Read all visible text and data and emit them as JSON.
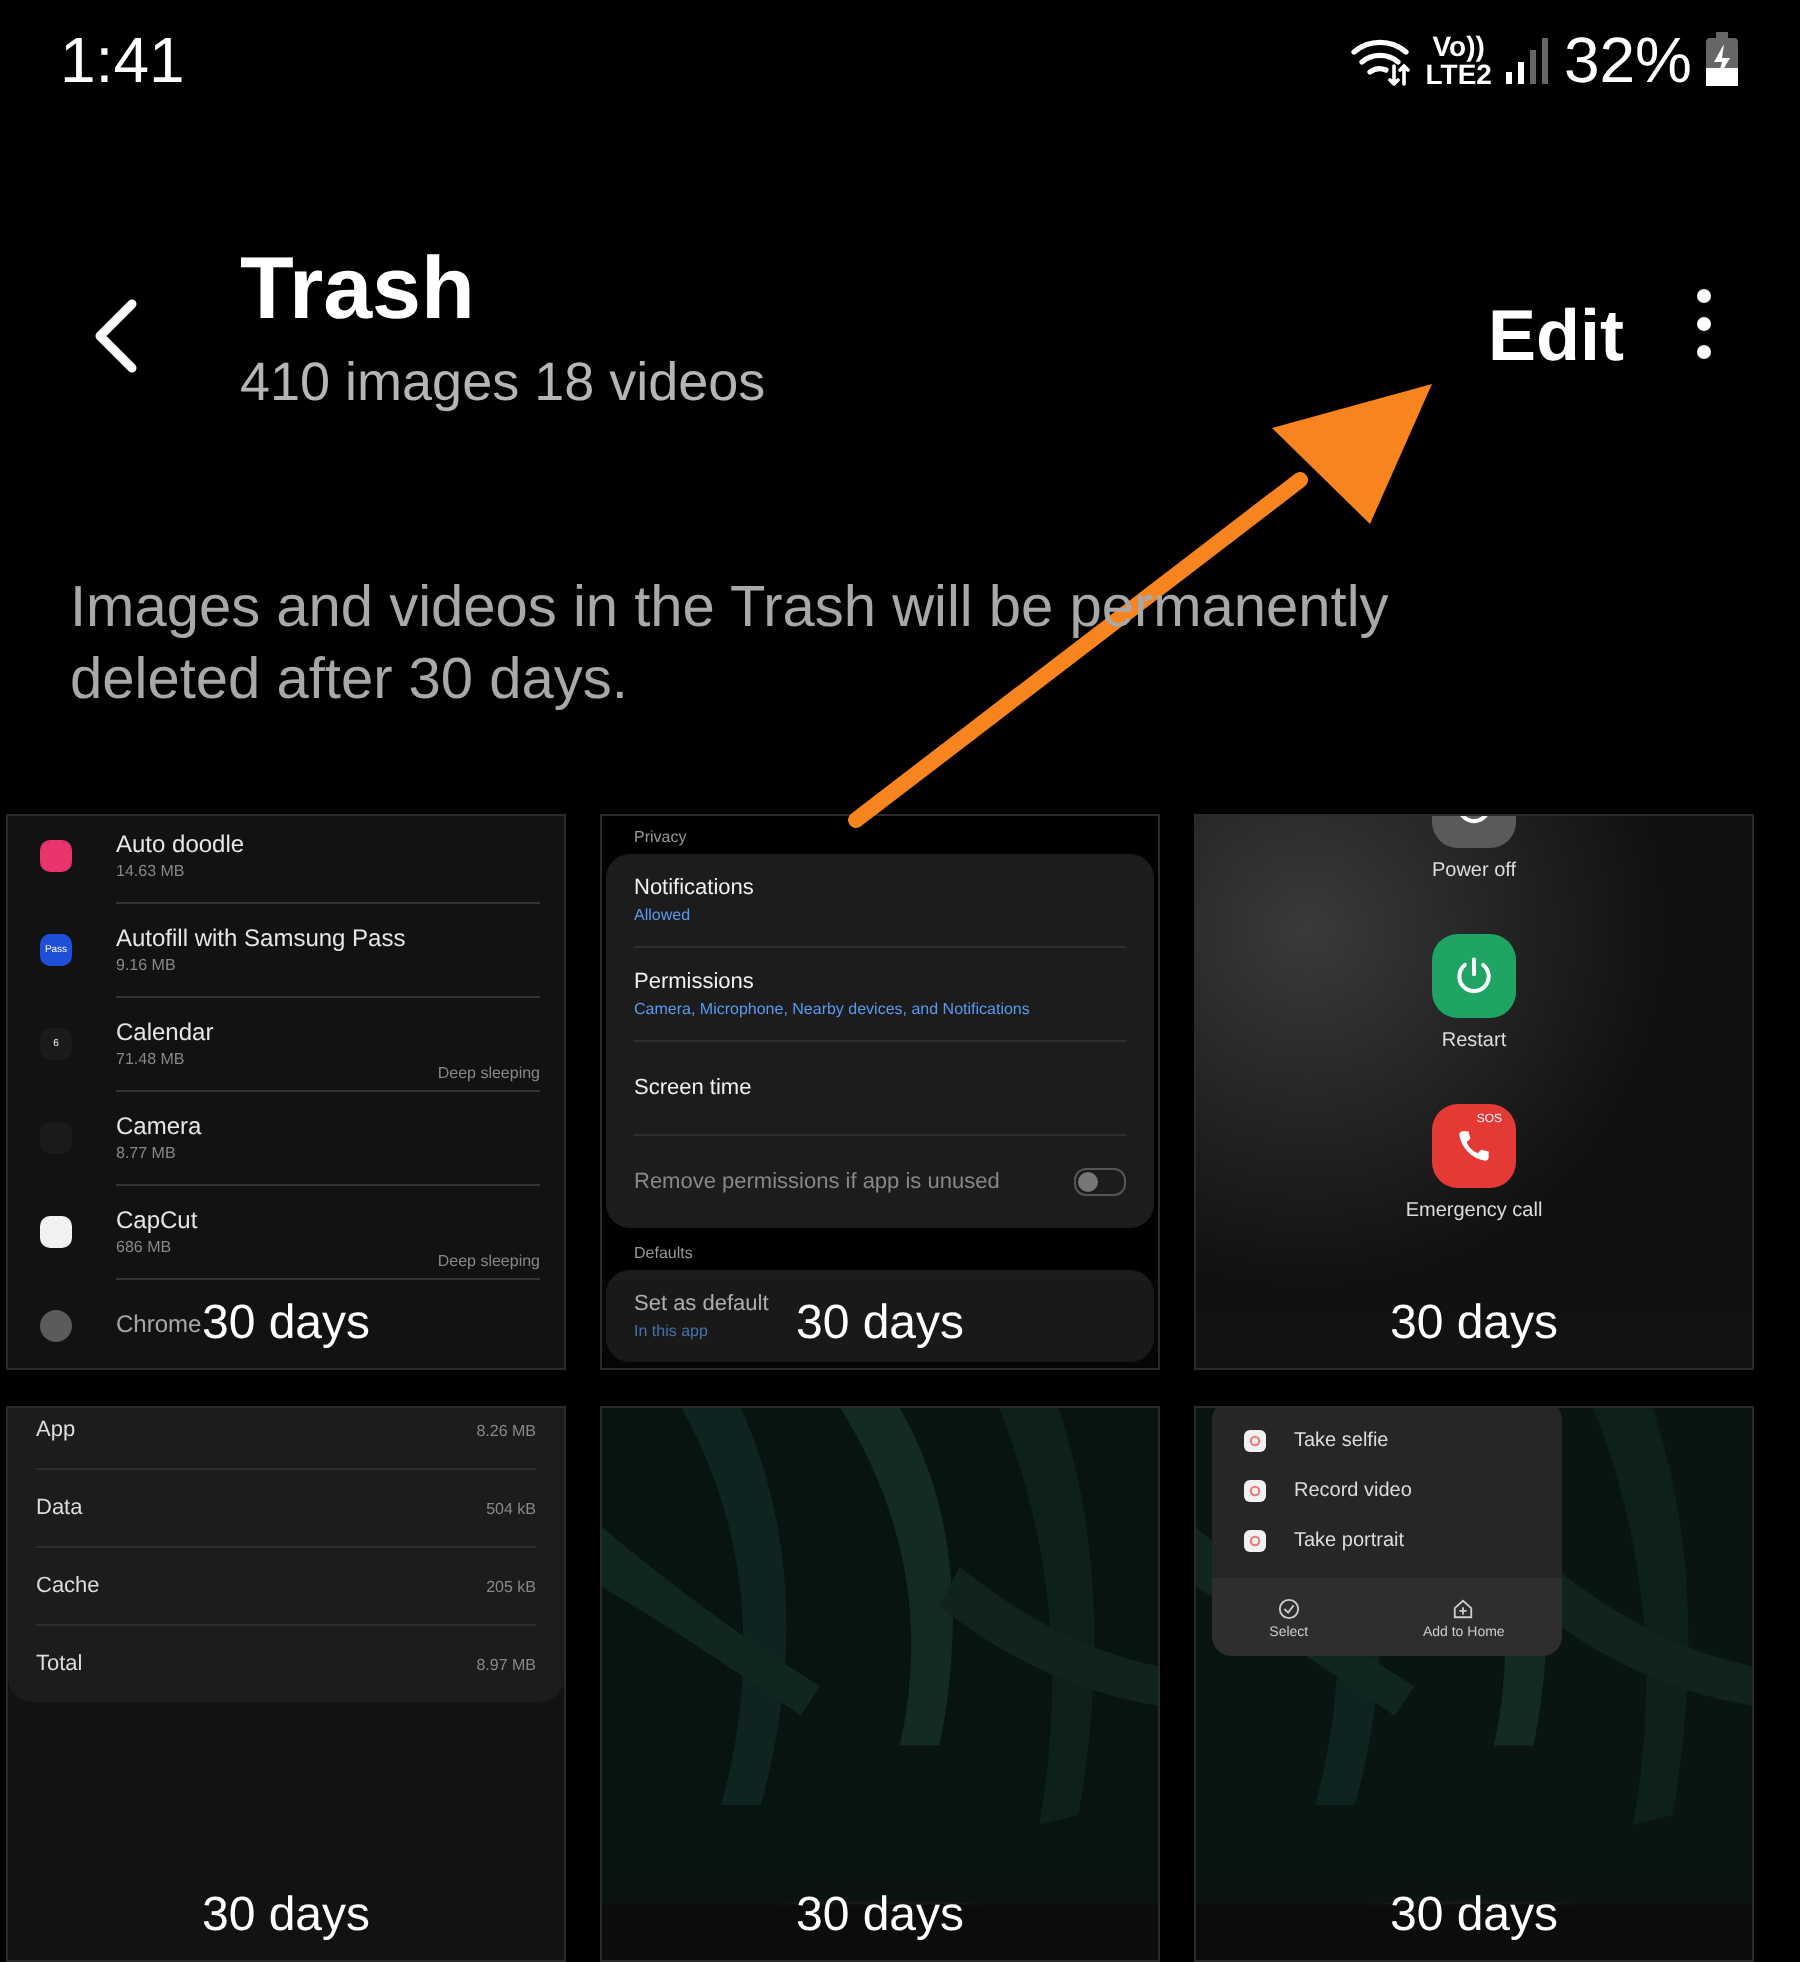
{
  "status_bar": {
    "time": "1:41",
    "volte": "Vo))",
    "network": "LTE2",
    "battery": "32%"
  },
  "header": {
    "title": "Trash",
    "subtitle": "410 images 18 videos",
    "action": "Edit"
  },
  "notice": "Images and videos in the Trash will be permanently deleted after 30 days.",
  "items": [
    {
      "kind": "app_list",
      "remaining": "30 days",
      "apps": [
        {
          "name": "Auto doodle",
          "size": "14.63 MB",
          "color": "#e8336b"
        },
        {
          "name": "Autofill with Samsung Pass",
          "size": "9.16 MB",
          "color": "#1d4fd8",
          "icon_text": "Pass"
        },
        {
          "name": "Calendar",
          "size": "71.48 MB",
          "note": "Deep sleeping",
          "color": "#1a1a1a",
          "icon_text": "6"
        },
        {
          "name": "Camera",
          "size": "8.77 MB",
          "color": "#1a1a1a"
        },
        {
          "name": "CapCut",
          "size": "686 MB",
          "note": "Deep sleeping",
          "color": "#f2f2f2"
        },
        {
          "name": "Chrome"
        }
      ]
    },
    {
      "kind": "settings",
      "remaining": "30 days",
      "sections": [
        {
          "heading": "Privacy",
          "rows": [
            {
              "title": "Notifications",
              "detail": "Allowed"
            },
            {
              "title": "Permissions",
              "detail": "Camera, Microphone, Nearby devices, and Notifications"
            },
            {
              "title": "Screen time"
            },
            {
              "title": "Remove permissions if app is unused",
              "disabled": true,
              "on": false
            }
          ]
        },
        {
          "heading": "Defaults",
          "rows": [
            {
              "title": "Set as default",
              "detail": "In this app"
            }
          ]
        }
      ]
    },
    {
      "kind": "power_menu",
      "remaining": "30 days",
      "buttons": [
        {
          "label": "Power off",
          "color": "#5a5a5a"
        },
        {
          "label": "Restart",
          "color": "#1fa463"
        },
        {
          "label": "Emergency call",
          "color": "#e53935",
          "icon_text": "SOS"
        }
      ]
    },
    {
      "kind": "storage",
      "remaining": "30 days",
      "rows": [
        {
          "label": "App",
          "value": "8.26 MB"
        },
        {
          "label": "Data",
          "value": "504 kB"
        },
        {
          "label": "Cache",
          "value": "205 kB"
        },
        {
          "label": "Total",
          "value": "8.97 MB"
        }
      ]
    },
    {
      "kind": "picture",
      "remaining": "30 days"
    },
    {
      "kind": "shortcut_menu",
      "remaining": "30 days",
      "entries": [
        "Take selfie",
        "Record video",
        "Take portrait"
      ],
      "actions": [
        "Select",
        "Add to Home"
      ]
    }
  ]
}
